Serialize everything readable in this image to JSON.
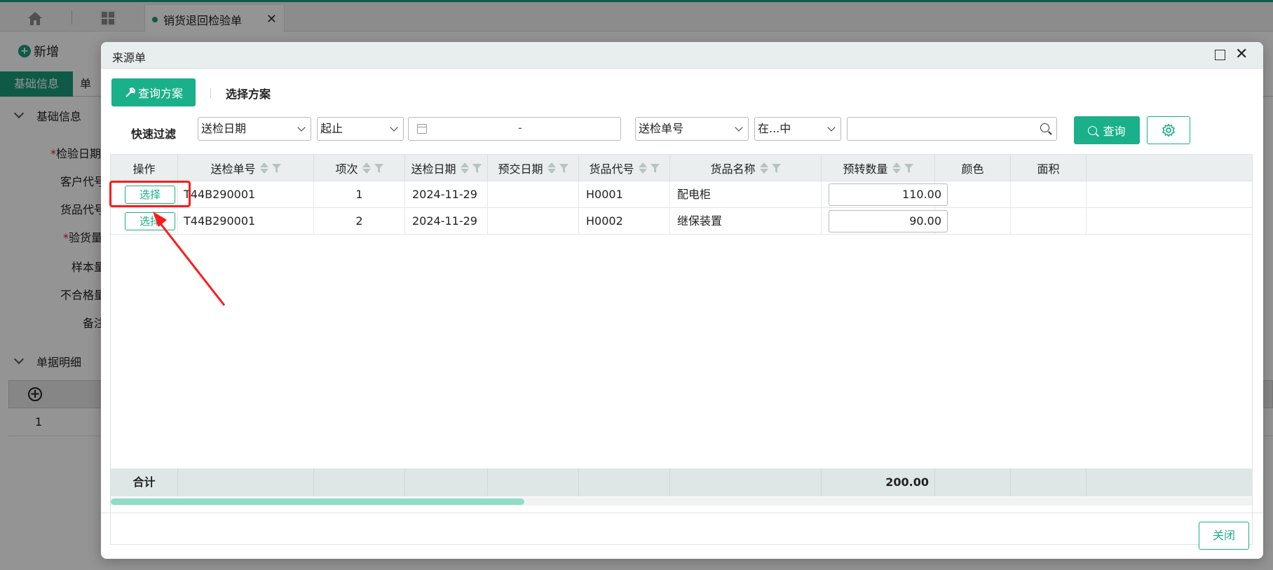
{
  "app": {
    "open_tab_label": "销货退回检验单",
    "new_button_label": "新增",
    "tab_basic_info": "基础信息",
    "tab_second_partial": "单",
    "section_basic_info": "基础信息",
    "section_bill_detail": "单据明细",
    "field_labels": [
      "检验日期",
      "客户代号",
      "货品代号",
      "验货量",
      "样本量",
      "不合格量",
      "备注"
    ],
    "field_required": [
      true,
      false,
      false,
      true,
      false,
      false,
      false
    ],
    "detail_row_index": "1"
  },
  "modal": {
    "title": "来源单",
    "query_plan_button": "查询方案",
    "choose_plan_label": "选择方案",
    "quick_filter_label": "快速过滤",
    "filter1_field": "送检日期",
    "filter1_operator": "起止",
    "date_separator": "-",
    "filter2_field": "送检单号",
    "filter2_operator": "在...中",
    "search_value": "",
    "search_button": "查询",
    "close_button": "关闭"
  },
  "table": {
    "columns": [
      "操作",
      "送检单号",
      "项次",
      "送检日期",
      "预交日期",
      "货品代号",
      "货品名称",
      "预转数量",
      "颜色",
      "面积"
    ],
    "rows": [
      {
        "action": "选择",
        "inspection_no": "T44B290001",
        "item_no": "1",
        "inspection_date": "2024-11-29",
        "due_date": "",
        "product_code": "H0001",
        "product_name": "配电柜",
        "qty": "110.00",
        "color": "",
        "area": ""
      },
      {
        "action": "选择",
        "inspection_no": "T44B290001",
        "item_no": "2",
        "inspection_date": "2024-11-29",
        "due_date": "",
        "product_code": "H0002",
        "product_name": "继保装置",
        "qty": "90.00",
        "color": "",
        "area": ""
      }
    ],
    "footer_label": "合计",
    "footer_qty_total": "200.00"
  },
  "colors": {
    "accent": "#1ab089",
    "annotation": "#ff1a1a"
  }
}
